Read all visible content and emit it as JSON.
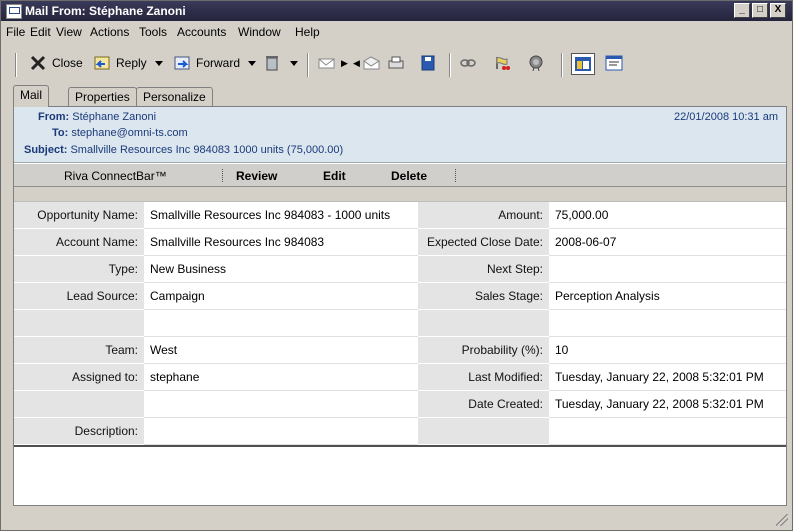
{
  "window": {
    "title": "Mail From: Stéphane Zanoni",
    "controls": [
      "_",
      "□",
      "X"
    ]
  },
  "menu": [
    "File",
    "Edit",
    "View",
    "Actions",
    "Tools",
    "Accounts",
    "Window",
    "Help"
  ],
  "toolbar": {
    "close_label": "Close",
    "reply_label": "Reply",
    "forward_label": "Forward"
  },
  "tabs": [
    "Mail",
    "Properties",
    "Personalize"
  ],
  "header": {
    "from_label": "From:",
    "from_value": "Stéphane Zanoni",
    "to_label": "To:",
    "to_value": "stephane@omni-ts.com",
    "subject_label": "Subject:",
    "subject_value": "Smallville Resources Inc  984083  1000 units  (75,000.00)",
    "date": "22/01/2008  10:31 am"
  },
  "connectbar": {
    "title": "Riva ConnectBar™",
    "review": "Review",
    "edit": "Edit",
    "delete": "Delete"
  },
  "fields": [
    {
      "k1": "Opportunity Name:",
      "v1": "Smallville Resources Inc 984083  -  1000 units",
      "k2": "Amount:",
      "v2": "75,000.00"
    },
    {
      "k1": "Account Name:",
      "v1": "Smallville Resources Inc  984083",
      "k2": "Expected Close Date:",
      "v2": "2008-06-07"
    },
    {
      "k1": "Type:",
      "v1": "New Business",
      "k2": "Next Step:",
      "v2": ""
    },
    {
      "k1": "Lead Source:",
      "v1": "Campaign",
      "k2": "Sales Stage:",
      "v2": "Perception Analysis"
    },
    {
      "k1": "",
      "v1": "",
      "k2": "",
      "v2": ""
    },
    {
      "k1": "Team:",
      "v1": "West",
      "k2": "Probability (%):",
      "v2": "10"
    },
    {
      "k1": "Assigned to:",
      "v1": "stephane",
      "k2": "Last Modified:",
      "v2": "Tuesday, January 22, 2008  5:32:01 PM"
    },
    {
      "k1": "",
      "v1": "",
      "k2": "Date Created:",
      "v2": "Tuesday, January 22, 2008  5:32:01 PM"
    },
    {
      "k1": "Description:",
      "v1": "",
      "k2": "",
      "v2": ""
    }
  ]
}
